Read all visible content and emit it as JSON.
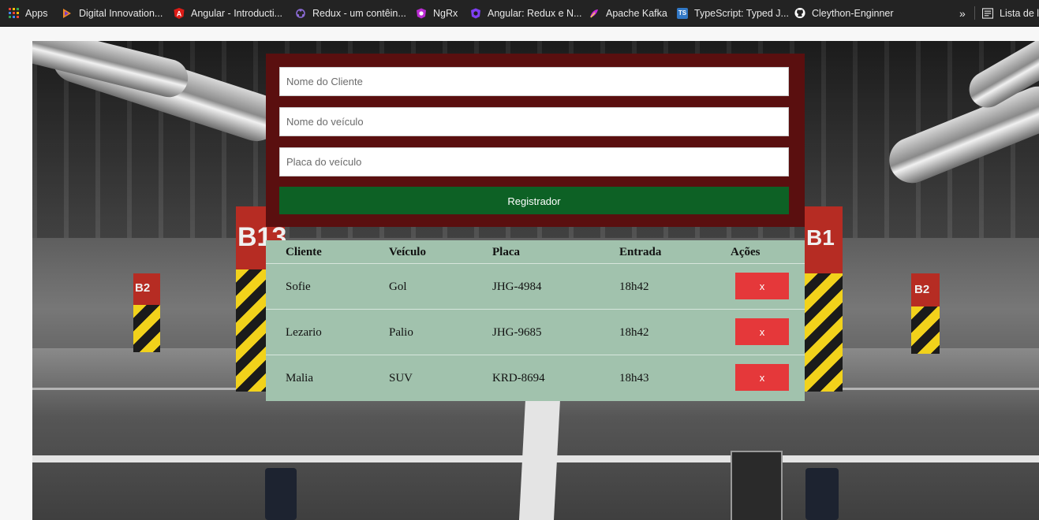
{
  "bookmarks": {
    "items": [
      {
        "label": "Apps",
        "icon": "apps-grid-icon",
        "color": "#f4b400"
      },
      {
        "label": "Digital Innovation...",
        "icon": "dio-icon",
        "color": "#f08a24"
      },
      {
        "label": "Angular - Introducti...",
        "icon": "angular-icon",
        "color": "#dd1b16"
      },
      {
        "label": "Redux - um contêin...",
        "icon": "redux-icon",
        "color": "#764abc"
      },
      {
        "label": "NgRx",
        "icon": "ngrx-icon",
        "color": "#ba2bd2"
      },
      {
        "label": "Angular: Redux e N...",
        "icon": "ngrx-icon",
        "color": "#7e3ff2"
      },
      {
        "label": "Apache Kafka",
        "icon": "kafka-icon",
        "color": "#c829d6"
      },
      {
        "label": "TypeScript: Typed J...",
        "icon": "typescript-icon",
        "color": "#3178c6"
      },
      {
        "label": "Cleython-Enginner",
        "icon": "github-icon",
        "color": "#ffffff"
      }
    ],
    "overflow": "»",
    "reading_list": "Lista de l"
  },
  "form": {
    "client_placeholder": "Nome do Cliente",
    "vehicle_placeholder": "Nome do veículo",
    "plate_placeholder": "Placa do veículo",
    "submit_label": "Registrador"
  },
  "table": {
    "headers": {
      "client": "Cliente",
      "vehicle": "Veículo",
      "plate": "Placa",
      "entry": "Entrada",
      "actions": "Ações"
    },
    "rows": [
      {
        "client": "Sofie",
        "vehicle": "Gol",
        "plate": "JHG-4984",
        "entry": "18h42",
        "action": "x"
      },
      {
        "client": "Lezario",
        "vehicle": "Palio",
        "plate": "JHG-9685",
        "entry": "18h42",
        "action": "x"
      },
      {
        "client": "Malia",
        "vehicle": "SUV",
        "plate": "KRD-8694",
        "entry": "18h43",
        "action": "x"
      }
    ]
  },
  "background": {
    "pillar_labels": [
      "B13",
      "B2",
      "B1",
      "B2"
    ]
  },
  "colors": {
    "form_bg": "#5a0f0f",
    "submit_bg": "#0d6125",
    "table_bg": "#a1c2ad",
    "delete_bg": "#e5383a"
  }
}
